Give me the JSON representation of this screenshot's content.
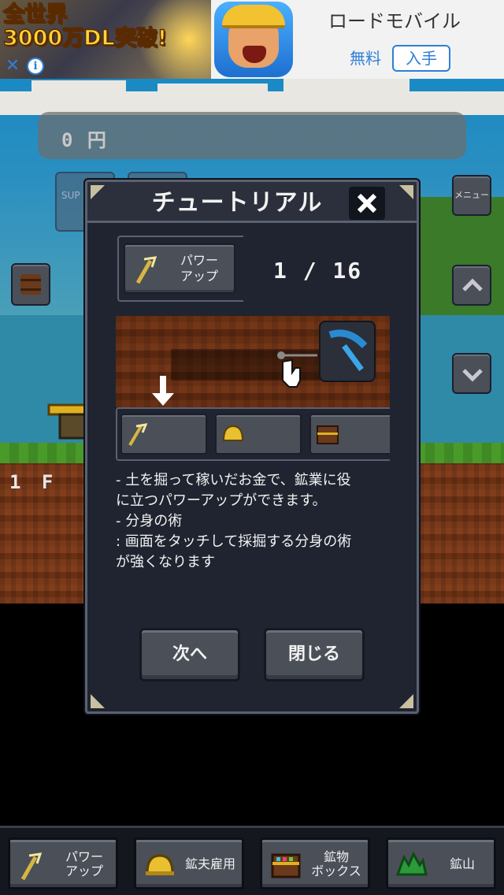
{
  "ad": {
    "headline": "全世界\n3000万DL突破!",
    "close_symbol": "✕",
    "info_symbol": "i",
    "app_name": "ロードモバイル",
    "price": "無料",
    "get_label": "入手"
  },
  "hud": {
    "money": "0 円",
    "menu_label": "メニュー",
    "skill_label": "SUP SKI",
    "floor": "1 F"
  },
  "tutorial": {
    "title": "チュートリアル",
    "tab_label": "パワー\nアップ",
    "page_current": "1",
    "page_separator": "/",
    "page_total": "16",
    "description": [
      "- 土を掘って稼いだお金で、鉱業に役",
      "に立つパワーアップができます。",
      "- 分身の術",
      ": 画面をタッチして採掘する分身の術",
      "が強くなります"
    ],
    "next_label": "次へ",
    "close_label": "閉じる"
  },
  "bottom_nav": [
    {
      "label": "パワー\nアップ",
      "icon": "pickaxe-icon"
    },
    {
      "label": "鉱夫雇用",
      "icon": "helmet-icon"
    },
    {
      "label": "鉱物\nボックス",
      "icon": "chest-icon"
    },
    {
      "label": "鉱山",
      "icon": "mountain-icon"
    }
  ],
  "colors": {
    "panel": "#1f2430",
    "button": "#4a4f58",
    "border": "#5a6170",
    "sky": "#1a8ac4",
    "grass": "#4a9a2a",
    "dirt": "#7a3a1a"
  }
}
